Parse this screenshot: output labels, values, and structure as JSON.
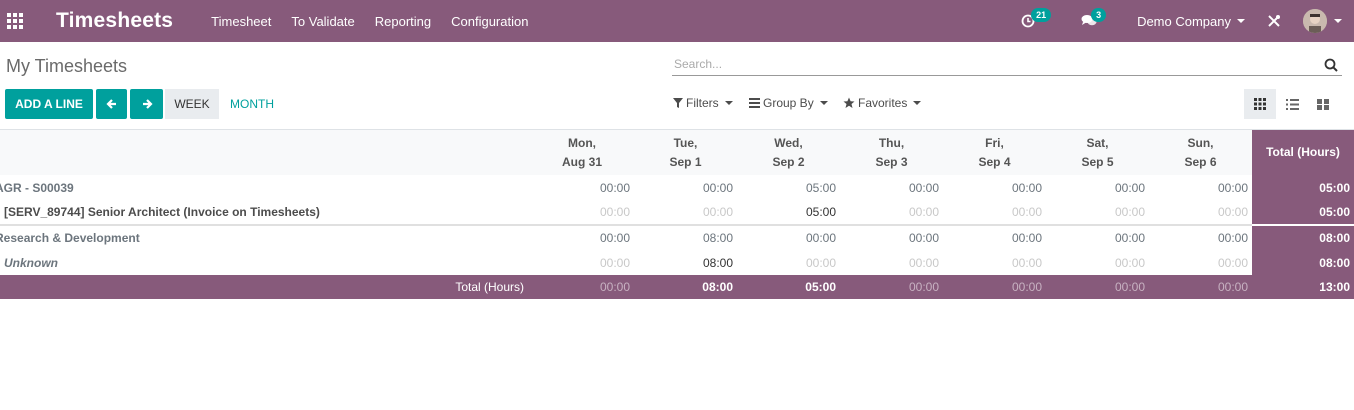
{
  "navbar": {
    "app_title": "Timesheets",
    "menu": [
      "Timesheet",
      "To Validate",
      "Reporting",
      "Configuration"
    ],
    "activity_count": "21",
    "messages_count": "3",
    "company": "Demo Company",
    "accent_color": "#875a7b"
  },
  "control_panel": {
    "breadcrumb": "My Timesheets",
    "search_placeholder": "Search...",
    "add_line_label": "ADD A LINE",
    "week_label": "WEEK",
    "month_label": "MONTH",
    "filters_label": "Filters",
    "group_by_label": "Group By",
    "favorites_label": "Favorites",
    "primary_color": "#00a09d"
  },
  "grid": {
    "days": [
      {
        "day": "Mon,",
        "date": "Aug 31"
      },
      {
        "day": "Tue,",
        "date": "Sep 1"
      },
      {
        "day": "Wed,",
        "date": "Sep 2"
      },
      {
        "day": "Thu,",
        "date": "Sep 3"
      },
      {
        "day": "Fri,",
        "date": "Sep 4"
      },
      {
        "day": "Sat,",
        "date": "Sep 5"
      },
      {
        "day": "Sun,",
        "date": "Sep 6"
      }
    ],
    "total_header": "Total (Hours)",
    "rows": [
      {
        "label": "AGR - S00039",
        "values": [
          "00:00",
          "00:00",
          "05:00",
          "00:00",
          "00:00",
          "00:00",
          "00:00"
        ],
        "total": "05:00"
      },
      {
        "label": "[SERV_89744] Senior Architect (Invoice on Timesheets)",
        "values": [
          "00:00",
          "00:00",
          "05:00",
          "00:00",
          "00:00",
          "00:00",
          "00:00"
        ],
        "total": "05:00"
      },
      {
        "label": "Research & Development",
        "values": [
          "00:00",
          "08:00",
          "00:00",
          "00:00",
          "00:00",
          "00:00",
          "00:00"
        ],
        "total": "08:00"
      },
      {
        "label": "Unknown",
        "values": [
          "00:00",
          "08:00",
          "00:00",
          "00:00",
          "00:00",
          "00:00",
          "00:00"
        ],
        "total": "08:00"
      }
    ],
    "footer_label": "Total (Hours)",
    "footer_values": [
      "00:00",
      "08:00",
      "05:00",
      "00:00",
      "00:00",
      "00:00",
      "00:00"
    ],
    "footer_total": "13:00"
  }
}
